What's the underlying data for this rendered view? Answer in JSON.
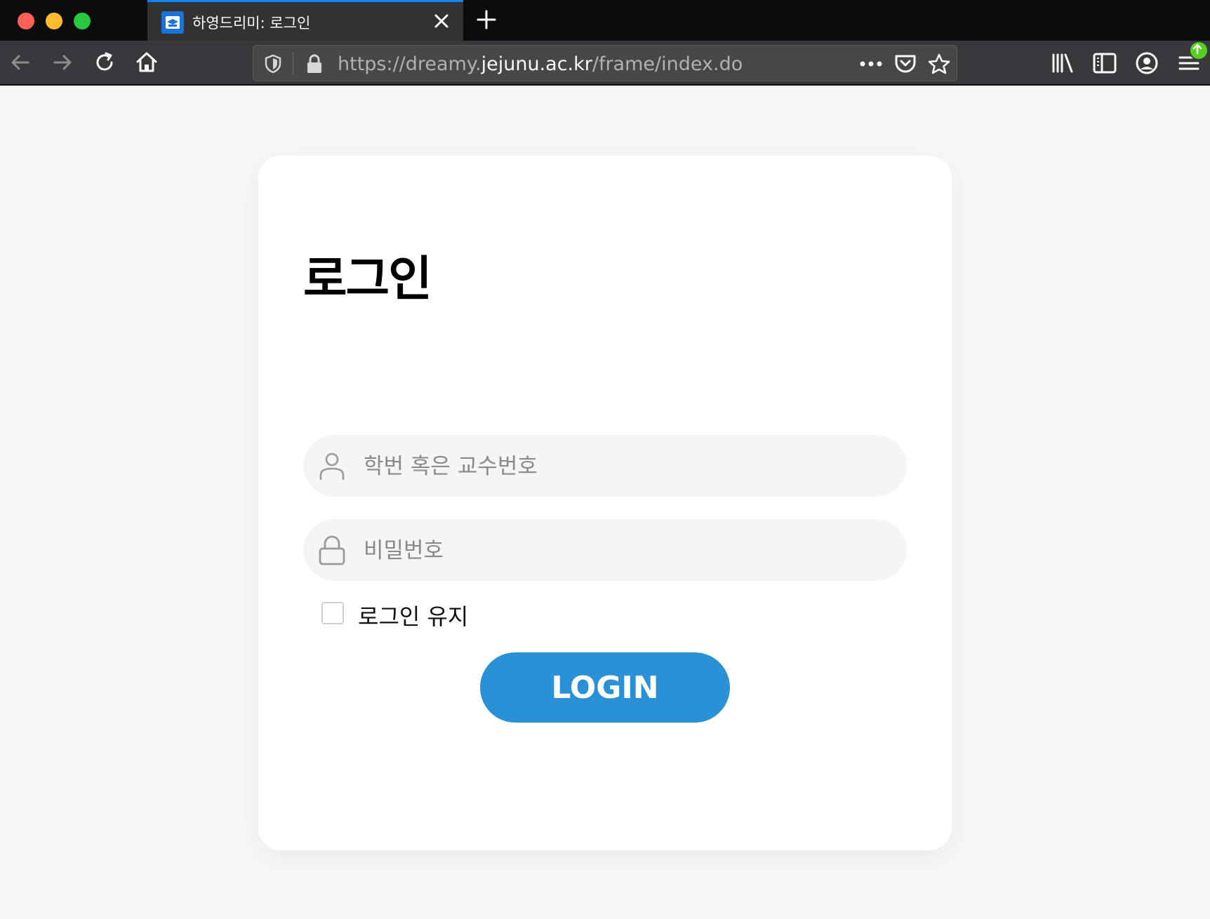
{
  "browser": {
    "tab_title": "하영드리미: 로그인",
    "url_scheme": "https://dreamy.",
    "url_host": "jejunu.ac.kr",
    "url_path": "/frame/index.do",
    "colors": {
      "tab_accent": "#0a84ff",
      "chrome_bg": "#0c0c0d",
      "toolbar_bg": "#38383d",
      "update_badge": "#54d11e"
    },
    "icons": [
      "back-icon",
      "forward-icon",
      "reload-icon",
      "home-icon",
      "tracking-shield-icon",
      "lock-icon",
      "more-actions-icon",
      "pocket-icon",
      "bookmark-star-icon",
      "library-icon",
      "sidebar-icon",
      "account-icon",
      "menu-icon",
      "update-arrow-icon",
      "close-icon",
      "plus-icon"
    ]
  },
  "login": {
    "title": "로그인",
    "id_placeholder": "학번 혹은 교수번호",
    "id_value": "",
    "password_placeholder": "비밀번호",
    "password_value": "",
    "keep_login_label": "로그인 유지",
    "keep_login_checked": false,
    "submit_label": "LOGIN",
    "colors": {
      "button": "#2a91d6",
      "page_bg": "#f7f7f7",
      "field_bg": "#f5f5f5"
    }
  }
}
